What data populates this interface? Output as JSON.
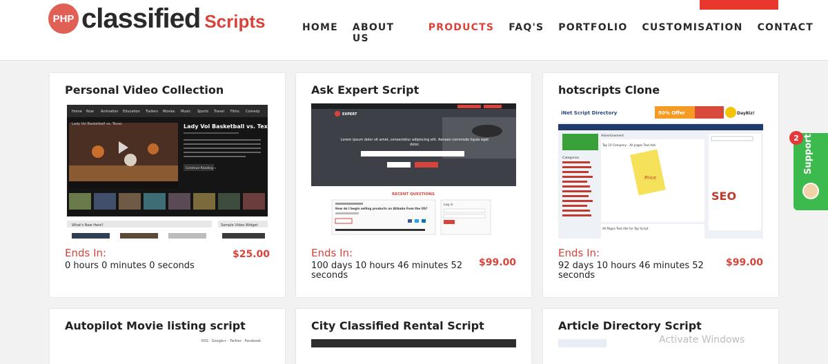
{
  "logo": {
    "badge": "PHP",
    "main": "classified",
    "sub": "Scripts"
  },
  "nav": [
    "HOME",
    "ABOUT US",
    "PRODUCTS",
    "FAQ'S",
    "PORTFOLIO",
    "CUSTOMISATION",
    "CONTACT"
  ],
  "nav_active": "PRODUCTS",
  "cards": [
    {
      "title": "Personal Video Collection",
      "ends_label": "Ends In:",
      "countdown": "0 hours  0 minutes  0 seconds",
      "price": "$25.00",
      "shot": {
        "menu": [
          "Home",
          "Now",
          "Animation",
          "Education",
          "Trailers",
          "Movies",
          "Music",
          "Sports",
          "Travel",
          "Films",
          "Comedy"
        ],
        "video_title": "Lady Vol Basketball vs. Texas",
        "panel_left": "What's New Here?",
        "panel_right": "Sample Video Widget",
        "button": "Continue Reading »"
      }
    },
    {
      "title": "Ask Expert Script",
      "ends_label": "Ends In:",
      "countdown": "100 days  10 hours  46 minutes  52 seconds",
      "price": "$99.00",
      "shot": {
        "brand": "EXPERT",
        "hero_text": "Lorem ipsum dolor sit amet, consectetur adipiscing elit. Aenean commodo ligula eget dolor.",
        "section": "RECENT QUESTIONS",
        "question": "How do I begin selling products on Alibaba from the US?",
        "login": "Log in"
      }
    },
    {
      "title": "hotscripts Clone",
      "ends_label": "Ends In:",
      "countdown": "92 days  10 hours  46 minutes  52 seconds",
      "price": "$99.00",
      "shot": {
        "brand": "iNet Script Directory",
        "offer": "50% Offer",
        "daybiz": "DayBiz!",
        "top": "Top 10 Company - All pages Text Ads",
        "seo": "SEO",
        "ad_heading": "Advertisement",
        "categories_heading": "Categories",
        "footer_ad": "All Pages Text Ads for Top Script"
      }
    },
    {
      "title": "Autopilot Movie listing script"
    },
    {
      "title": "City Classified Rental Script"
    },
    {
      "title": "Article Directory Script"
    }
  ],
  "support": {
    "label": "Support",
    "badge": "2"
  },
  "watermark": "Activate Windows",
  "colors": {
    "accent": "#d9433a",
    "support": "#3cba4e"
  }
}
